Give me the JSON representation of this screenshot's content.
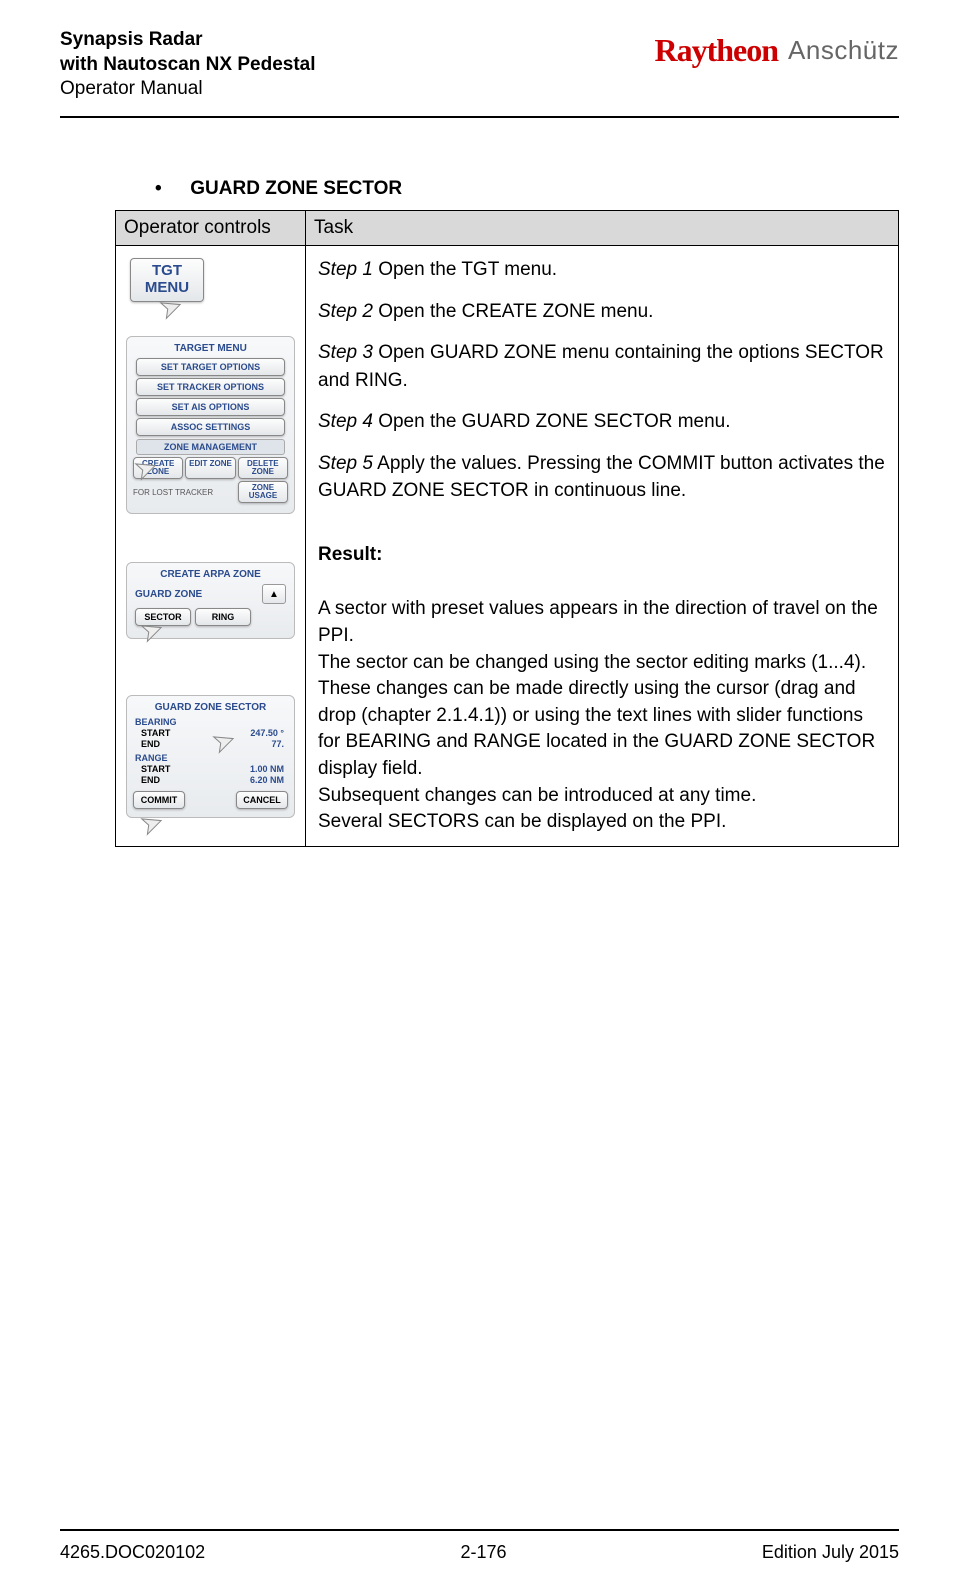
{
  "header": {
    "title_line1": "Synapsis Radar",
    "title_line2": "with Nautoscan NX Pedestal",
    "title_line3": "Operator Manual",
    "brand1": "Raytheon",
    "brand2": "Anschütz"
  },
  "section": {
    "bullet": "•",
    "title": "GUARD ZONE SECTOR"
  },
  "table": {
    "col1": "Operator controls",
    "col2": "Task"
  },
  "controls": {
    "tgt_menu": "TGT\nMENU",
    "target_menu_title": "TARGET MENU",
    "btns": {
      "set_target": "SET TARGET OPTIONS",
      "set_tracker": "SET TRACKER OPTIONS",
      "set_ais": "SET AIS OPTIONS",
      "assoc": "ASSOC SETTINGS"
    },
    "zone_mgmt": "ZONE MANAGEMENT",
    "create_zone": "CREATE ZONE",
    "edit_zone": "EDIT ZONE",
    "delete_zone": "DELETE ZONE",
    "for_lost": "FOR LOST TRACKER",
    "zone_usage": "ZONE USAGE",
    "create_arpa_title": "CREATE ARPA ZONE",
    "guard_zone": "GUARD ZONE",
    "sector": "SECTOR",
    "ring": "RING",
    "gzs_title": "GUARD ZONE SECTOR",
    "bearing": "BEARING",
    "range": "RANGE",
    "start": "START",
    "end": "END",
    "b_start_v": "247.50 °",
    "b_end_v": "77.",
    "r_start_v": "1.00 NM",
    "r_end_v": "6.20 NM",
    "commit": "COMMIT",
    "cancel": "CANCEL"
  },
  "task": {
    "s1_lbl": "Step 1",
    "s1_txt": " Open the TGT menu.",
    "s2_lbl": "Step 2",
    "s2_txt": " Open the CREATE ZONE menu.",
    "s3_lbl": "Step 3",
    "s3_txt": " Open GUARD ZONE menu containing the options SECTOR and RING.",
    "s4_lbl": "Step 4",
    "s4_txt": " Open the GUARD ZONE SECTOR menu.",
    "s5_lbl": "Step 5",
    "s5_txt": " Apply the values. Pressing the COMMIT button activates the GUARD ZONE SECTOR in continuous line.",
    "result_label": "Result:",
    "result_p1": "A sector with preset values appears in the direction of travel on the PPI.",
    "result_p2": "The sector can be changed using the sector editing marks (1...4).",
    "result_p3": "These changes can be made directly using the cursor (drag and drop (chapter 2.1.4.1)) or using the text lines with slider functions for BEARING and RANGE located in the GUARD ZONE SECTOR display field.",
    "result_p4": "Subsequent changes can be introduced at any time.",
    "result_p5": "Several SECTORS can be displayed on the PPI."
  },
  "footer": {
    "doc": "4265.DOC020102",
    "page": "2-176",
    "edition": "Edition July 2015"
  }
}
